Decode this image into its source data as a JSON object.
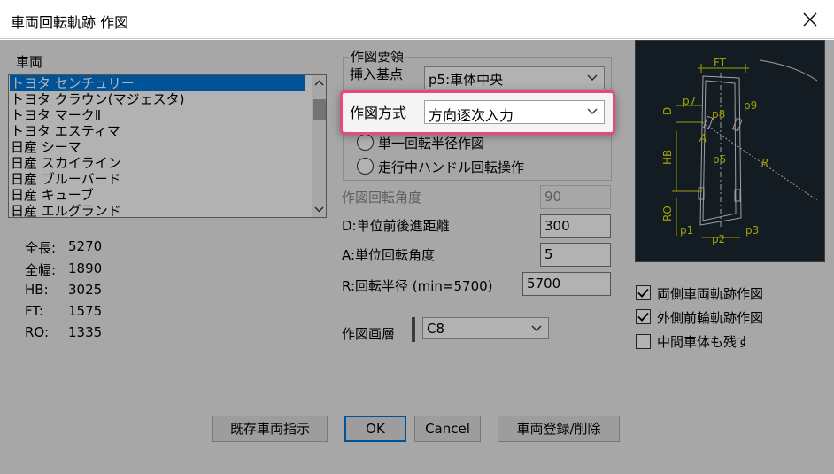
{
  "window": {
    "title": "車両回転軌跡 作図"
  },
  "vehicle": {
    "label": "車両",
    "items": [
      "トヨタ センチュリー",
      "トヨタ クラウン(マジェスタ)",
      "トヨタ マークⅡ",
      "トヨタ エスティマ",
      "日産 シーマ",
      "日産 スカイライン",
      "日産 ブルーバード",
      "日産 キューブ",
      "日産 エルグランド"
    ],
    "selected_index": 0
  },
  "specs": [
    {
      "label": "全長:",
      "value": "5270"
    },
    {
      "label": "全幅:",
      "value": "1890"
    },
    {
      "label": "HB:",
      "value": "3025"
    },
    {
      "label": "FT:",
      "value": "1575"
    },
    {
      "label": "RO:",
      "value": "1335"
    }
  ],
  "group": {
    "title": "作図要領",
    "insert_point_label": "挿入基点",
    "insert_point_value": "p5:車体中央",
    "method_label": "作図方式",
    "method_value": "方向逐次入力",
    "radio1": "単一回転半径作図",
    "radio2": "走行中ハンドル回転操作"
  },
  "fields": {
    "angle_label": "作図回転角度",
    "angle_value": "90",
    "dist_label": "D:単位前後進距離",
    "dist_value": "300",
    "unit_angle_label": "A:単位回転角度",
    "unit_angle_value": "5",
    "radius_label": "R:回転半径 (min=5700)",
    "radius_value": "5700",
    "layer_label": "作図画層",
    "layer_value": "C8"
  },
  "preview": {
    "labels": {
      "ft": "FT",
      "d": "D",
      "hb": "HB",
      "ro": "RO",
      "a": "A",
      "r": "R",
      "p1": "p1",
      "p2": "p2",
      "p3": "p3",
      "p5": "p5",
      "p7": "p7",
      "p8": "p8",
      "p9": "p9"
    },
    "colors": {
      "background": "#1c2833",
      "lines": "#e6e6e6",
      "dimension": "#e6e600"
    }
  },
  "options": [
    {
      "label": "両側車両軌跡作図",
      "checked": true
    },
    {
      "label": "外側前輪軌跡作図",
      "checked": true
    },
    {
      "label": "中間車体も残す",
      "checked": false
    }
  ],
  "buttons": {
    "existing": "既存車両指示",
    "ok": "OK",
    "cancel": "Cancel",
    "register": "車両登録/削除"
  }
}
